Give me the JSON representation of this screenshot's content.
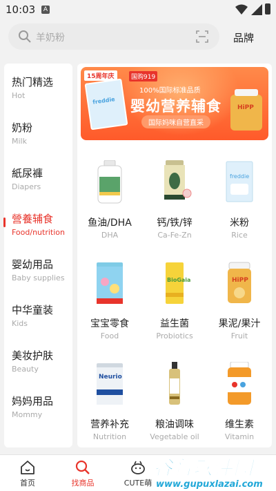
{
  "status_bar": {
    "time": "10:03",
    "notification_letter": "A"
  },
  "search": {
    "placeholder": "羊奶粉",
    "brand_label": "品牌"
  },
  "colors": {
    "accent": "#e8342b",
    "banner": "#ff6a30"
  },
  "sidebar": {
    "items": [
      {
        "label": "热门精选",
        "sub": "Hot",
        "active": false
      },
      {
        "label": "奶粉",
        "sub": "Milk",
        "active": false
      },
      {
        "label": "紙尿褲",
        "sub": "Diapers",
        "active": false
      },
      {
        "label": "營養辅食",
        "sub": "Food/nutrition",
        "active": true
      },
      {
        "label": "婴幼用品",
        "sub": "Baby supplies",
        "active": false
      },
      {
        "label": "中华童装",
        "sub": "Kids",
        "active": false
      },
      {
        "label": "美妆护肤",
        "sub": "Beauty",
        "active": false
      },
      {
        "label": "妈妈用品",
        "sub": "Mommy",
        "active": false
      }
    ]
  },
  "banner": {
    "anniversary": "15周年庆",
    "event": "国购919",
    "subtitle": "100%国际标准品质",
    "title": "婴幼营养辅食",
    "pill": "国际妈咪自营直采",
    "box_label": "freddie",
    "jar_label": "HiPP"
  },
  "categories": [
    {
      "label": "鱼油/DHA",
      "sub": "DHA",
      "icon": "fish-oil-bottle-icon",
      "color": "#ffffff"
    },
    {
      "label": "钙/铁/锌",
      "sub": "Ca-Fe-Zn",
      "icon": "calcium-jar-icon",
      "color": "#e9e3b8"
    },
    {
      "label": "米粉",
      "sub": "Rice",
      "icon": "rice-cereal-box-icon",
      "color": "#dff0fb"
    },
    {
      "label": "宝宝零食",
      "sub": "Food",
      "icon": "snack-can-icon",
      "color": "#8fd3f0"
    },
    {
      "label": "益生菌",
      "sub": "Probiotics",
      "icon": "probiotics-box-icon",
      "color": "#f6d33a"
    },
    {
      "label": "果泥/果汁",
      "sub": "Fruit",
      "icon": "fruit-puree-jar-icon",
      "color": "#f0b64a"
    },
    {
      "label": "营养补充",
      "sub": "Nutrition",
      "icon": "nutrition-can-icon",
      "color": "#eef2f6"
    },
    {
      "label": "粮油调味",
      "sub": "Vegetable oil",
      "icon": "oil-bottle-icon",
      "color": "#d8c17a"
    },
    {
      "label": "维生素",
      "sub": "Vitamin",
      "icon": "vitamin-jar-icon",
      "color": "#f39a2a"
    }
  ],
  "tabbar": [
    {
      "label": "首页",
      "icon": "home-icon",
      "active": false
    },
    {
      "label": "找商品",
      "icon": "search-icon",
      "active": true
    },
    {
      "label": "CUTE萌",
      "icon": "cute-face-icon",
      "active": false
    }
  ],
  "watermark": {
    "title": "谷普软件园",
    "url": "www.gupuxlazai.com"
  }
}
